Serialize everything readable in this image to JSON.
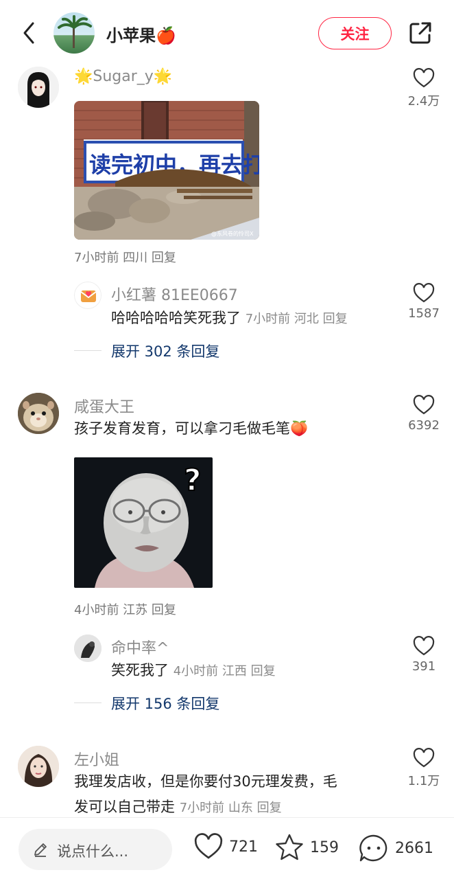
{
  "header": {
    "user_name": "小苹果🍎",
    "follow_label": "关注"
  },
  "comments": [
    {
      "user": "🌟Sugar_y🌟",
      "meta": "7小时前 四川 回复",
      "likes": "2.4万",
      "image_watermark": "@东风卷的怜司X",
      "image_banner_text": "读完初中，再去打工",
      "reply": {
        "user": "小红薯 81EE0667",
        "text": "哈哈哈哈哈笑死我了",
        "meta": "7小时前 河北 回复",
        "likes": "1587"
      },
      "expand": "展开 302 条回复"
    },
    {
      "user": "咸蛋大王",
      "text": "孩子发育发育，可以拿刁毛做毛笔🍑",
      "likes": "6392",
      "meta": "4小时前 江苏 回复",
      "reply": {
        "user": "命中率^",
        "text": "笑死我了",
        "meta": "4小时前 江西 回复",
        "likes": "391"
      },
      "expand": "展开 156 条回复"
    },
    {
      "user": "左小姐",
      "text_line1": "我理发店收，但是你要付30元理发费，毛",
      "text_line2": "发可以自己带走",
      "meta": "7小时前 山东 回复",
      "likes": "1.1万"
    }
  ],
  "bottom_bar": {
    "input_placeholder": "说点什么...",
    "likes": "721",
    "stars": "159",
    "comments": "2661"
  },
  "colors": {
    "accent": "#ff2442",
    "link": "#13386c",
    "muted": "#8a8a8a"
  }
}
